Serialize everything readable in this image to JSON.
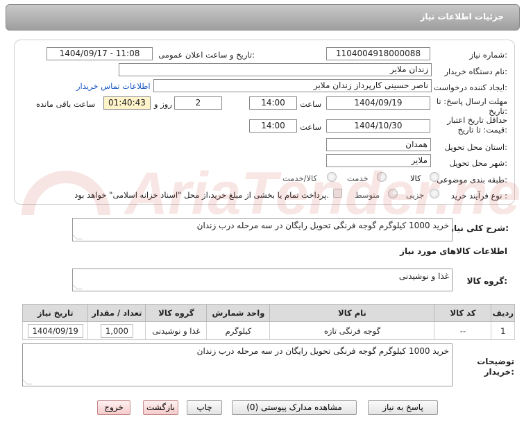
{
  "header": {
    "title": "جزئیات اطلاعات نیاز"
  },
  "form": {
    "need_number_label": "شماره نیاز:",
    "need_number": "1104004918000088",
    "announce_label": "تاریخ و ساعت اعلان عمومی:",
    "announce_value": "1404/09/17 - 11:08",
    "buyer_org_label": "نام دستگاه خریدار:",
    "buyer_org": "زندان ملایر",
    "requester_label": "ایجاد کننده درخواست:",
    "requester": "ناصر  حسینی کارپرداز زندان ملایر",
    "contact_link": "اطلاعات تماس خریدار",
    "deadline_label_1": "مهلت ارسال پاسخ: تا",
    "deadline_label_2": "تاریخ:",
    "deadline_date": "1404/09/19",
    "time_label": "ساعت",
    "deadline_time": "14:00",
    "days_value": "2",
    "days_label": "روز و",
    "remaining_time": "01:40:43",
    "remaining_label": "ساعت باقی مانده",
    "validity_label_1": "حداقل تاریخ اعتبار",
    "validity_label_2": "قیمت: تا تاریخ:",
    "validity_date": "1404/10/30",
    "validity_time": "14:00",
    "province_label": "استان محل تحویل:",
    "province": "همدان",
    "city_label": "شهر محل تحویل:",
    "city": "ملایر",
    "category_label": "طبقه بندی موضوعی:",
    "category_options": [
      "کالا",
      "خدمت",
      "کالا/خدمت"
    ],
    "process_label": "نوع فرآیند خرید :",
    "process_options": [
      "جزیی",
      "متوسط"
    ],
    "payment_note": "پرداخت تمام یا بخشی از مبلغ خرید،از محل \"اسناد خزانه اسلامی\" خواهد بود."
  },
  "summary": {
    "label": "شرح کلی نیاز:",
    "text": "خرید 1000 کیلوگرم گوجه فرنگی تحویل رایگان در سه مرحله درب زندان"
  },
  "goods": {
    "section_title": "اطلاعات کالاهای مورد نیاز",
    "group_label": "گروه کالا:",
    "group_value": "غذا و نوشیدنی",
    "columns": [
      "ردیف",
      "کد کالا",
      "نام کالا",
      "واحد شمارش",
      "گروه کالا",
      "تعداد / مقدار",
      "تاریخ نیاز"
    ],
    "rows": [
      [
        "1",
        "--",
        "گوجه فرنگی تازه",
        "کیلوگرم",
        "غذا و نوشیدنی",
        "1,000",
        "1404/09/19"
      ]
    ]
  },
  "buyer_notes": {
    "label_1": "توضیحات",
    "label_2": "خریدار:",
    "text": "خرید 1000 کیلوگرم گوجه فرنگی تحویل رایگان در سه مرحله درب زندان"
  },
  "buttons": {
    "reply": "پاسخ به نیاز",
    "view_docs": "مشاهده مدارک پیوستی (0)",
    "print": "چاپ",
    "back": "بازگشت",
    "exit": "خروج"
  },
  "watermark": {
    "text": "AriaTender.neT"
  },
  "colors": {
    "link": "#1a56c4",
    "header": "#a8a8a8",
    "remaining_bg": "#fff3c9"
  }
}
